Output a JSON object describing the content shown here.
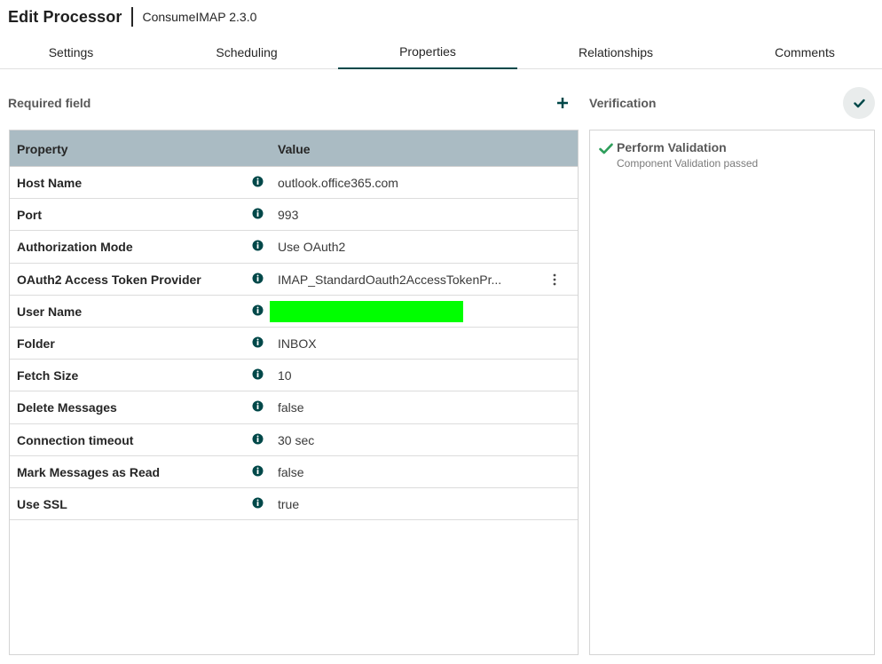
{
  "header": {
    "title": "Edit Processor",
    "subtitle": "ConsumeIMAP 2.3.0"
  },
  "tabs": [
    {
      "label": "Settings",
      "active": false
    },
    {
      "label": "Scheduling",
      "active": false
    },
    {
      "label": "Properties",
      "active": true
    },
    {
      "label": "Relationships",
      "active": false
    },
    {
      "label": "Comments",
      "active": false
    }
  ],
  "properties_panel": {
    "required_label": "Required field",
    "add_icon": "plus-icon",
    "columns": {
      "property": "Property",
      "value": "Value"
    },
    "rows": [
      {
        "name": "Host Name",
        "value": "outlook.office365.com"
      },
      {
        "name": "Port",
        "value": "993"
      },
      {
        "name": "Authorization Mode",
        "value": "Use OAuth2"
      },
      {
        "name": "OAuth2 Access Token Provider",
        "value": "IMAP_StandardOauth2AccessTokenPr..."
      },
      {
        "name": "User Name",
        "value": ""
      },
      {
        "name": "Folder",
        "value": "INBOX"
      },
      {
        "name": "Fetch Size",
        "value": "10"
      },
      {
        "name": "Delete Messages",
        "value": "false"
      },
      {
        "name": "Connection timeout",
        "value": "30 sec"
      },
      {
        "name": "Mark Messages as Read",
        "value": "false"
      },
      {
        "name": "Use SSL",
        "value": "true"
      }
    ]
  },
  "verification": {
    "label": "Verification",
    "item_title": "Perform Validation",
    "item_status": "Component Validation passed"
  },
  "colors": {
    "accent": "#004849",
    "header_row_bg": "#aabbc3",
    "success": "#2e9e5b",
    "redaction": "#00ff00"
  }
}
